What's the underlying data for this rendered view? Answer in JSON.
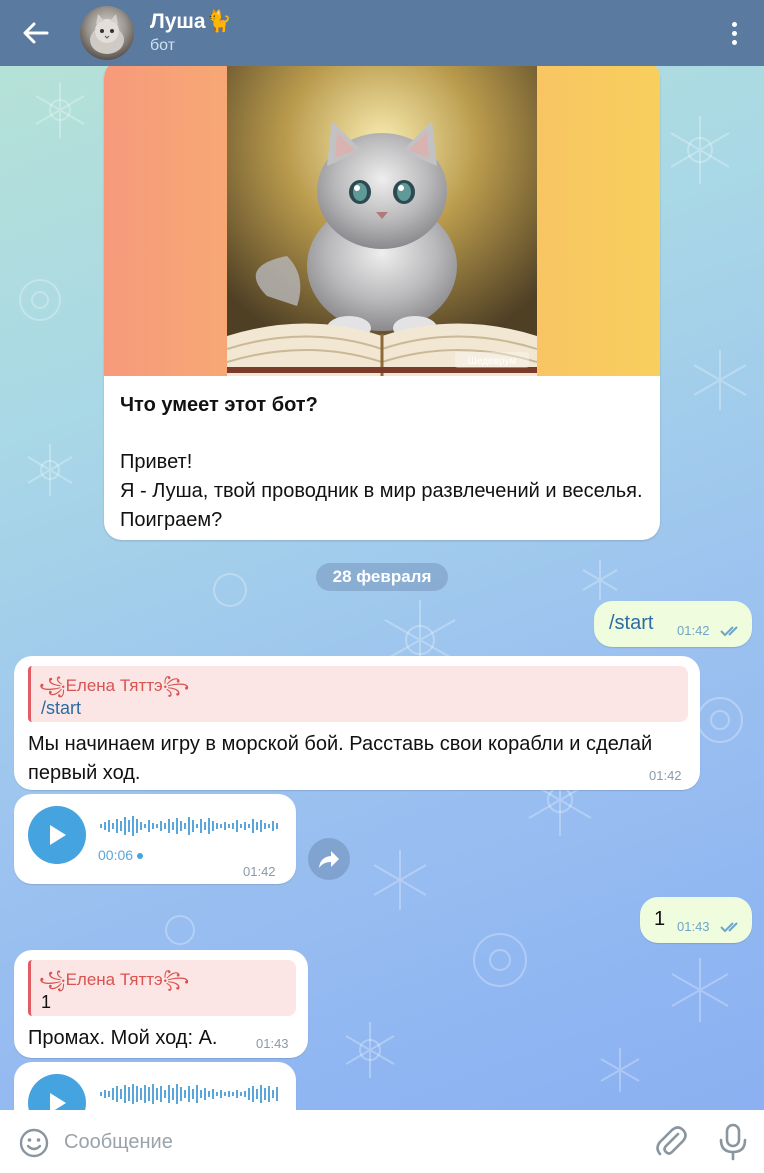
{
  "header": {
    "title": "Луша🐈",
    "subtitle": "бот"
  },
  "intro": {
    "title": "Что умеет этот бот?",
    "body": "Привет!\nЯ - Луша, твой проводник в мир развлечений и веселья. Поиграем?",
    "image_caption": "Шедеврум"
  },
  "date_separator": "28 февраля",
  "messages": {
    "m1": {
      "text": "/start",
      "time": "01:42"
    },
    "m2": {
      "reply_name": "Елена Тяттэ",
      "reply_text": "/start",
      "text": "Мы начинаем игру в морской бой. Расставь свои корабли и сделай первый ход.",
      "time": "01:42"
    },
    "m3": {
      "duration": "00:06",
      "time": "01:42"
    },
    "m4": {
      "text": "1",
      "time": "01:43"
    },
    "m5": {
      "reply_name": "Елена Тяттэ",
      "reply_text": "1",
      "text": "Промах. Мой ход: А.",
      "time": "01:43"
    }
  },
  "composer": {
    "placeholder": "Сообщение"
  },
  "colors": {
    "header": "#5a7aa0",
    "outgoing_bubble": "#effdde",
    "accent": "#45a3e0",
    "reply_name": "#d9534f"
  },
  "icons": [
    "back-arrow-icon",
    "more-vert-icon",
    "play-icon",
    "share-icon",
    "emoji-icon",
    "paperclip-icon",
    "microphone-icon",
    "double-check-icon"
  ]
}
